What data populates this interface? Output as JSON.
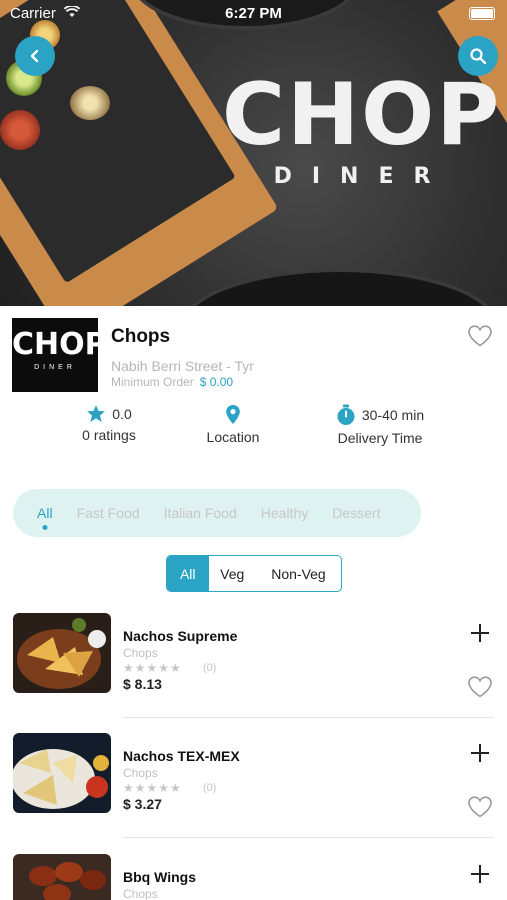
{
  "status": {
    "carrier": "Carrier",
    "time": "6:27 PM"
  },
  "hero": {
    "logo_main": "CHOPS",
    "logo_sub": "DINER"
  },
  "restaurant": {
    "logo_main": "CHOPS",
    "logo_sub": "DINER",
    "name": "Chops",
    "street": "Nabih Berri Street - Tyr",
    "min_order_label": "Minimum Order",
    "min_order_value": "$ 0.00"
  },
  "stats": {
    "rating_value": "0.0",
    "rating_label": "0 ratings",
    "location_label": "Location",
    "delivery_value": "30-40 min",
    "delivery_label": "Delivery Time"
  },
  "categories": [
    "All",
    "Fast Food",
    "Italian Food",
    "Healthy",
    "Dessert"
  ],
  "filter": [
    "All",
    "Veg",
    "Non-Veg"
  ],
  "items": [
    {
      "name": "Nachos Supreme",
      "restaurant": "Chops",
      "stars": "★★★★★",
      "count": "(0)",
      "price": "$ 8.13"
    },
    {
      "name": "Nachos TEX-MEX",
      "restaurant": "Chops",
      "stars": "★★★★★",
      "count": "(0)",
      "price": "$ 3.27"
    },
    {
      "name": "Bbq Wings",
      "restaurant": "Chops",
      "stars": "★★★★★",
      "count": "(0)",
      "price": ""
    }
  ],
  "colors": {
    "accent": "#2aa3c4",
    "category_bg": "#dff2f2",
    "muted": "#c7c7c7"
  }
}
